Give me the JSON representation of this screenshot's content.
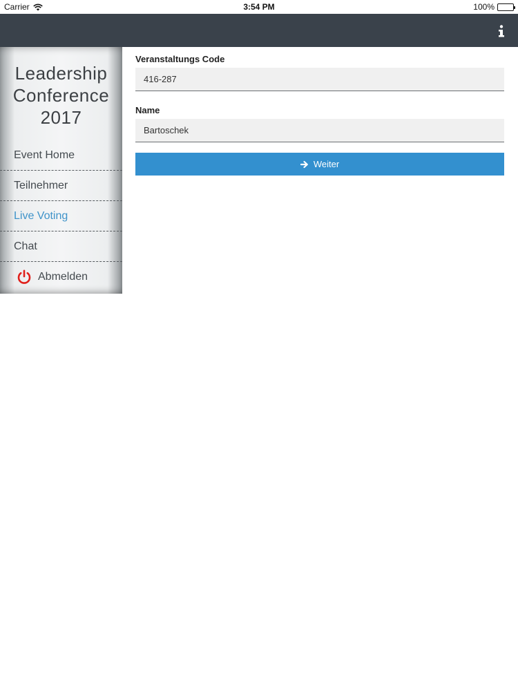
{
  "statusbar": {
    "carrier": "Carrier",
    "time": "3:54 PM",
    "battery": "100%"
  },
  "navbar": {
    "info_icon": "info-icon"
  },
  "sidebar": {
    "event_title_lines": [
      "Leadership",
      "Conference",
      "2017"
    ],
    "items": [
      {
        "label": "Event Home",
        "active": false
      },
      {
        "label": "Teilnehmer",
        "active": false
      },
      {
        "label": "Live Voting",
        "active": true
      },
      {
        "label": "Chat",
        "active": false
      }
    ],
    "logout": {
      "label": "Abmelden",
      "icon": "power-icon",
      "icon_color": "#e0201b"
    }
  },
  "form": {
    "code_label": "Veranstaltungs Code",
    "code_value": "416-287",
    "name_label": "Name",
    "name_value": "Bartoschek",
    "submit_label": "Weiter",
    "submit_icon": "arrow-right-icon"
  },
  "colors": {
    "navbar": "#3a424b",
    "accent": "#3390cf",
    "active_menu": "#3f93c9"
  }
}
